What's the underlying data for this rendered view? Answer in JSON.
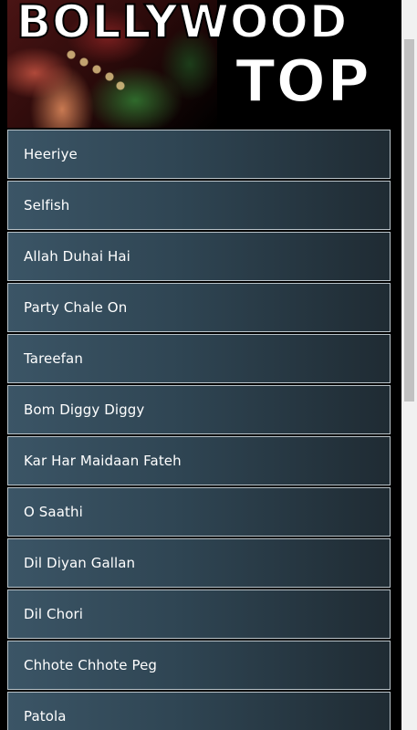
{
  "banner": {
    "line1": "BOLLYWOOD",
    "line2": "TOP"
  },
  "songs": [
    "Heeriye",
    "Selfish",
    "Allah Duhai Hai",
    "Party Chale On",
    "Tareefan",
    "Bom Diggy Diggy",
    "Kar Har Maidaan Fateh",
    "O Saathi",
    "Dil Diyan Gallan",
    "Dil Chori",
    "Chhote Chhote Peg",
    "Patola"
  ],
  "colors": {
    "item_border": "#b8c2c8",
    "item_gradient_start": "#3b5566",
    "item_gradient_end": "#1f2b33",
    "text": "#ffffff",
    "background": "#000000"
  }
}
